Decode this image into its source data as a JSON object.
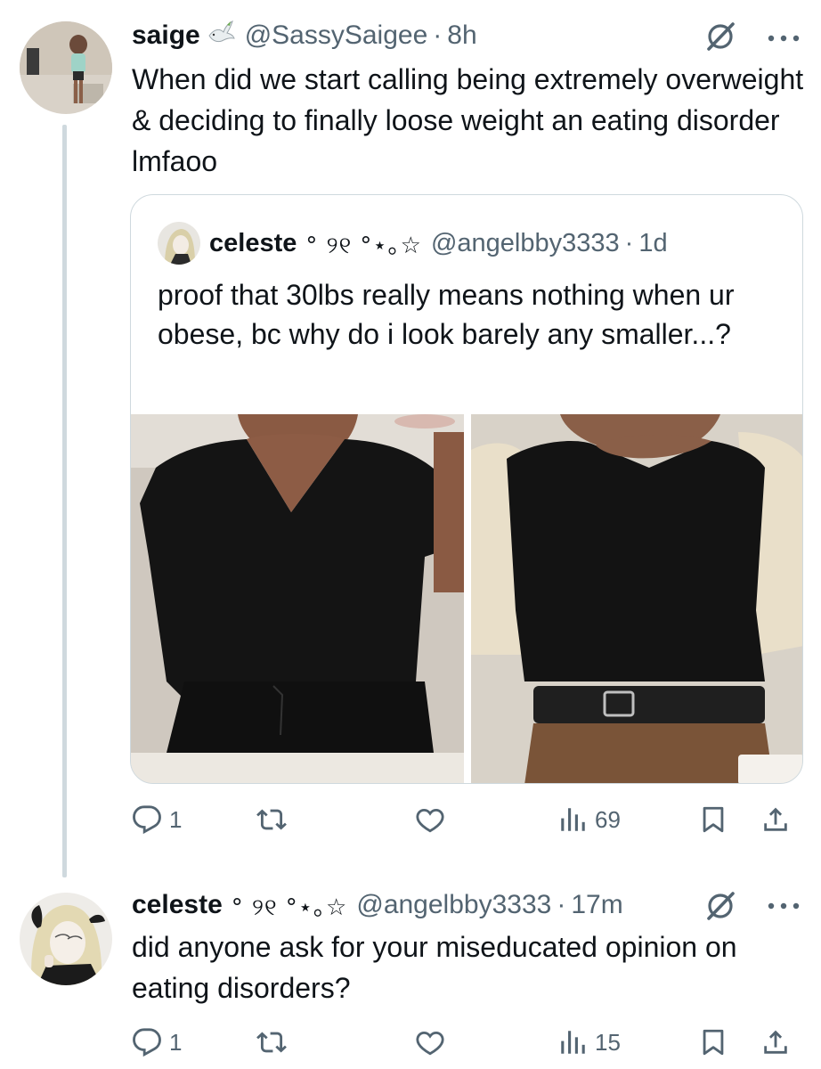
{
  "main_tweet": {
    "author_name": "saige",
    "handle": "@SassySaigee",
    "separator": "·",
    "time": "8h",
    "text": "When did we start calling being extremely overweight & deciding to finally loose weight an eating disorder lmfaoo",
    "actions": {
      "replies": "1",
      "reposts": "",
      "likes": "",
      "views": "69"
    }
  },
  "quoted_tweet": {
    "author_name": "celeste",
    "name_symbols": "° ୨୧ °⋆｡☆",
    "handle": "@angelbby3333",
    "separator": "·",
    "time": "1d",
    "text": "proof that 30lbs really means nothing when ur obese, bc why do i look barely any smaller...?"
  },
  "reply_tweet": {
    "author_name": "celeste",
    "name_symbols": "° ୨୧ °⋆｡☆",
    "handle": "@angelbby3333",
    "separator": "·",
    "time": "17m",
    "text": "did anyone ask for your miseducated opinion on eating disorders?",
    "actions": {
      "replies": "1",
      "reposts": "",
      "likes": "",
      "views": "15"
    }
  },
  "colors": {
    "text_primary": "#0f1419",
    "text_secondary": "#536471",
    "border": "#cfd9de",
    "thread_line": "#cfd9de"
  },
  "icons": [
    "reply-icon",
    "repost-icon",
    "like-icon",
    "views-icon",
    "bookmark-icon",
    "share-icon",
    "grok-icon",
    "more-icon",
    "dove-emoji"
  ]
}
